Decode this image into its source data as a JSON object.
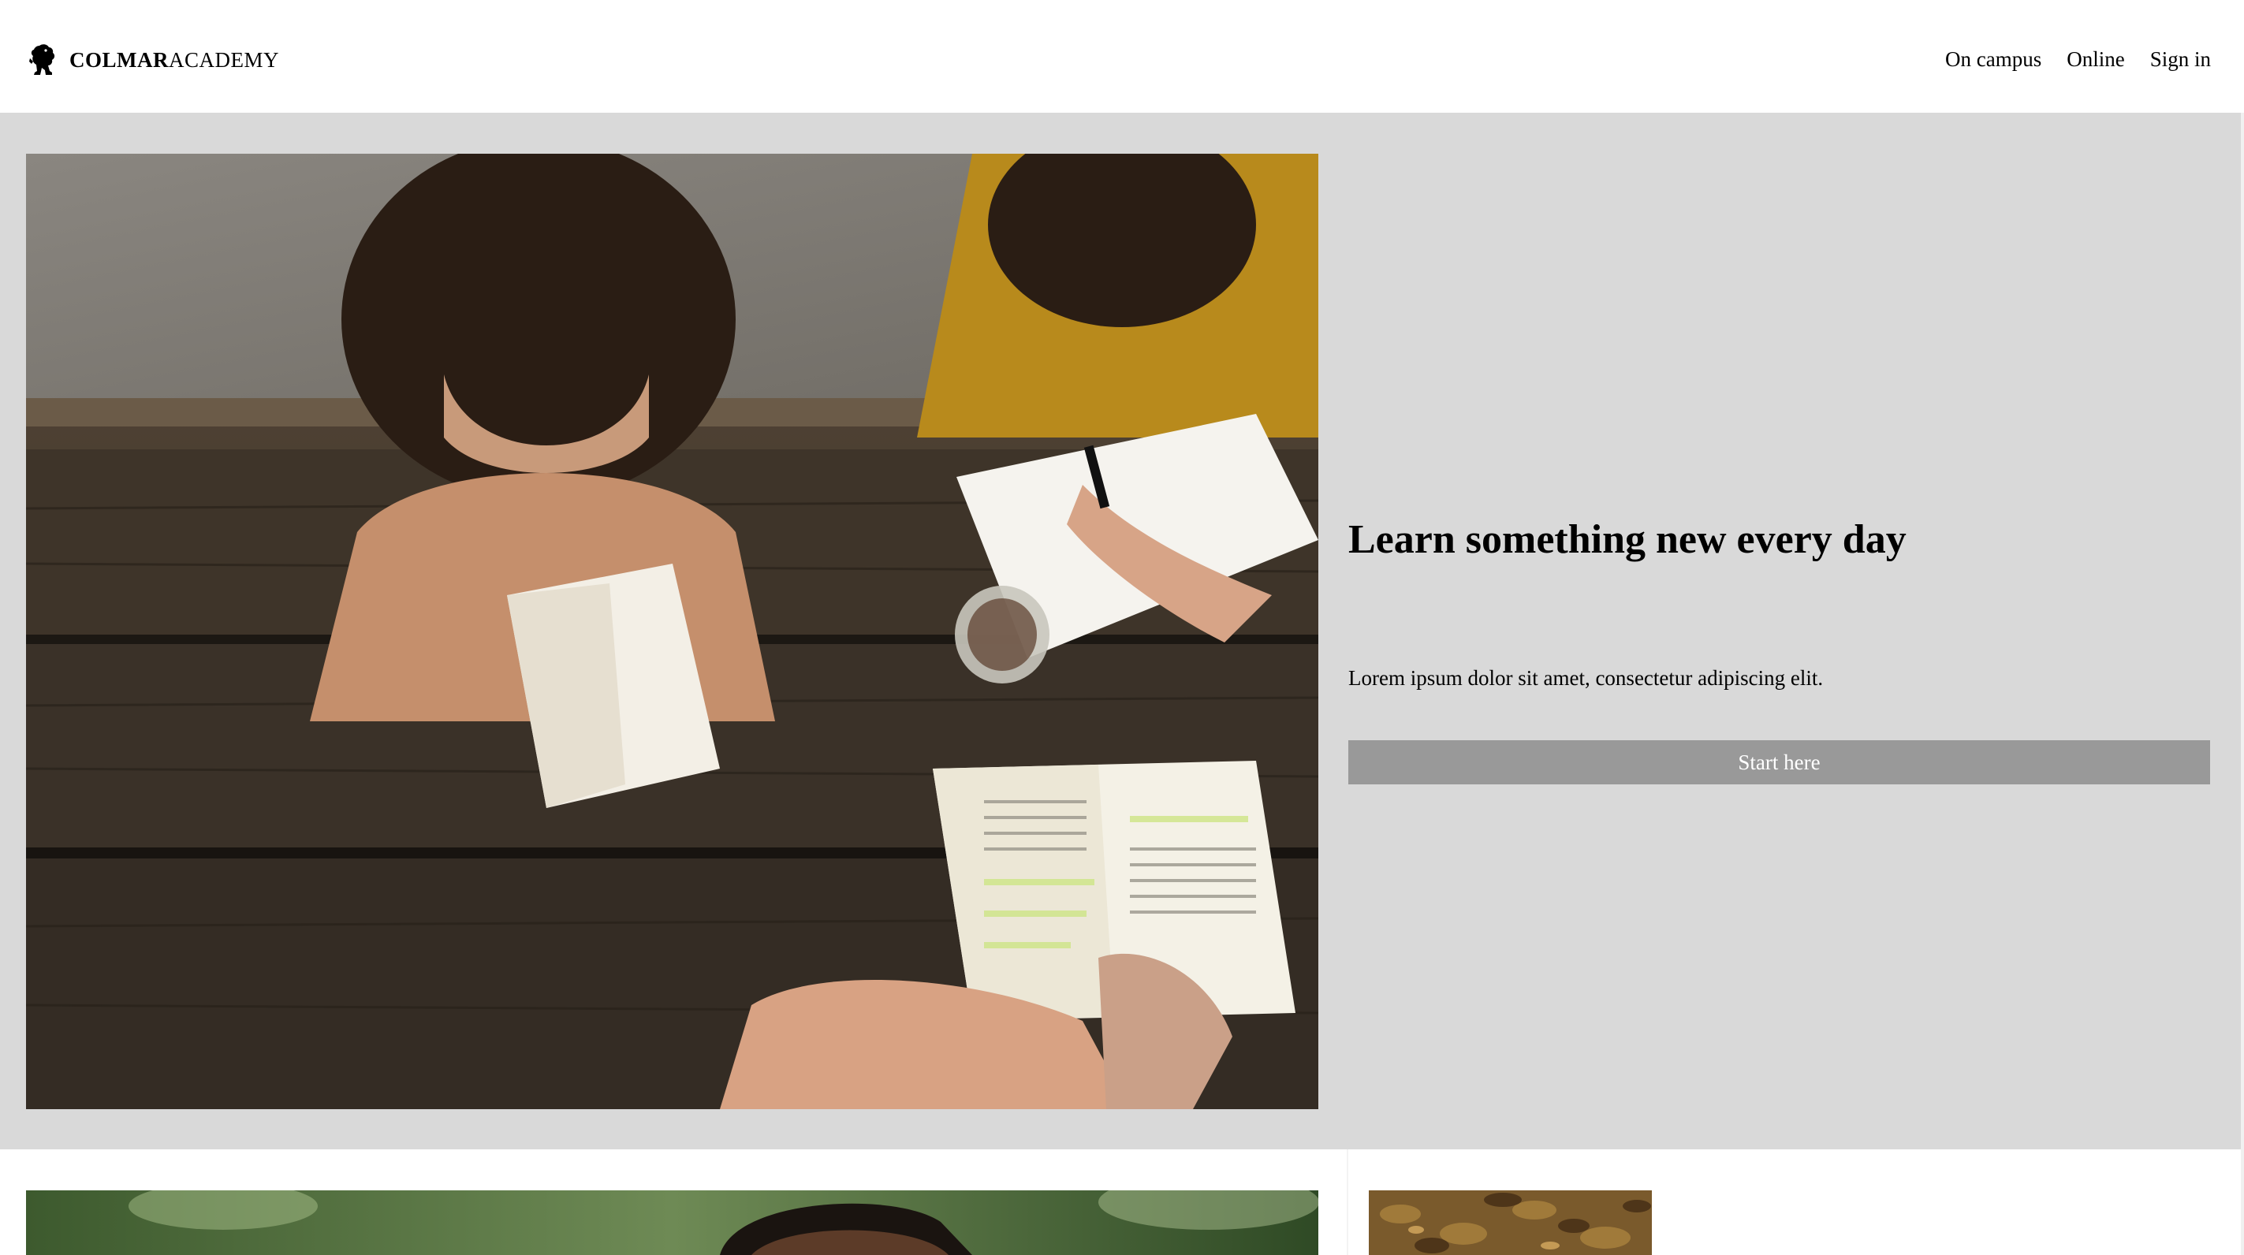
{
  "brand": {
    "name_bold": "COLMAR",
    "name_regular": "ACADEMY",
    "icon": "griffin-logo-icon"
  },
  "nav": {
    "items": [
      {
        "label": "On campus"
      },
      {
        "label": "Online"
      },
      {
        "label": "Sign in"
      }
    ]
  },
  "hero": {
    "image": "students-studying-photo",
    "title": "Learn something new every day",
    "text": "Lorem ipsum dolor sit amet, consectetur adipiscing elit.",
    "button_label": "Start here"
  },
  "cards": [
    {
      "image": "student-portrait-photo"
    },
    {
      "image": "autumn-leaves-photo"
    }
  ],
  "colors": {
    "hero_bg": "#d9d9d9",
    "button_bg": "#999999",
    "button_text": "#ffffff"
  }
}
